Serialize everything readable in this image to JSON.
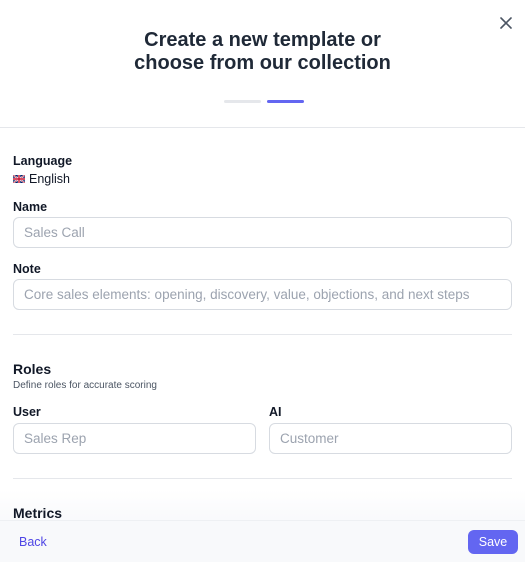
{
  "dialog": {
    "title_line1": "Create a new template or",
    "title_line2": "choose from our collection",
    "steps": {
      "count": 2,
      "current": 2,
      "active_color": "#6366f1",
      "inactive_color": "#e5e7eb"
    }
  },
  "language": {
    "label": "Language",
    "flag": "uk-flag-icon",
    "value": "English"
  },
  "name": {
    "label": "Name",
    "placeholder": "Sales Call"
  },
  "note": {
    "label": "Note",
    "placeholder": "Core sales elements: opening, discovery, value, objections, and next steps"
  },
  "roles": {
    "title": "Roles",
    "subtitle": "Define roles for accurate scoring",
    "user": {
      "label": "User",
      "placeholder": "Sales Rep"
    },
    "ai": {
      "label": "AI",
      "placeholder": "Customer"
    }
  },
  "metrics": {
    "title": "Metrics"
  },
  "footer": {
    "back_label": "Back",
    "save_label": "Save",
    "accent": "#6366f1"
  }
}
